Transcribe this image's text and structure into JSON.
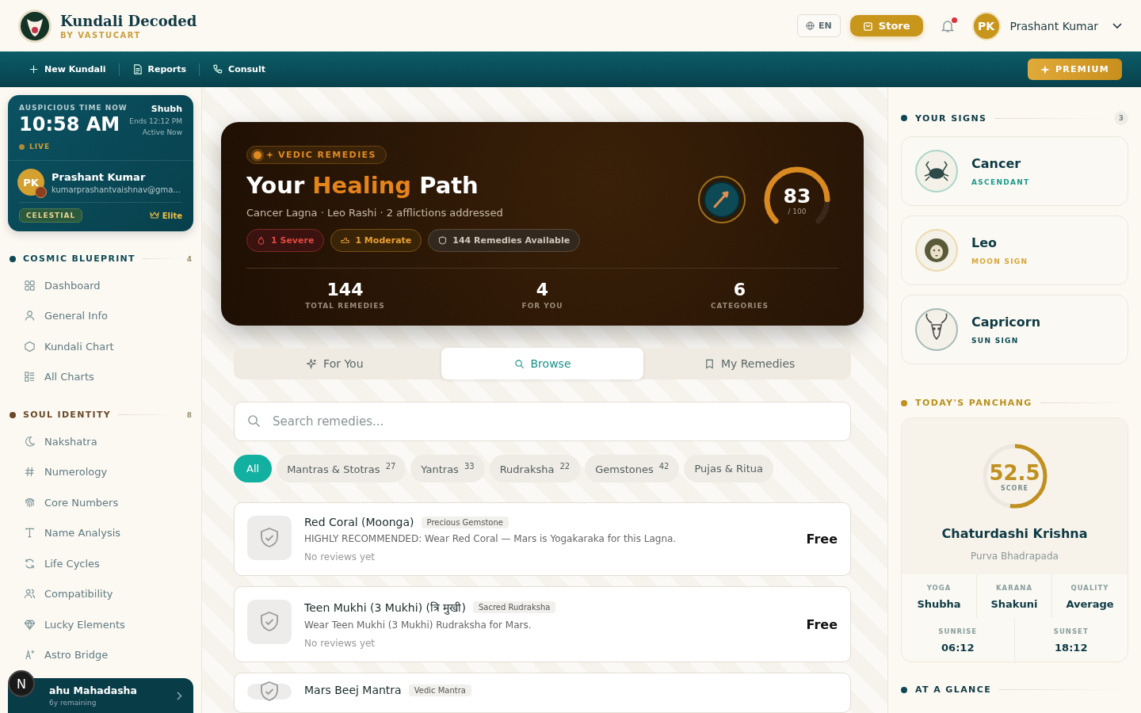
{
  "header": {
    "brand": "Kundali Decoded",
    "tagline": "BY VASTUCART",
    "language": "EN",
    "store": "Store",
    "notifications_unread": true,
    "user": {
      "initials": "PK",
      "name": "Prashant Kumar"
    }
  },
  "nav": {
    "items": [
      "New Kundali",
      "Reports",
      "Consult"
    ],
    "premium": "PREMIUM"
  },
  "auspicious": {
    "label": "AUSPICIOUS TIME NOW",
    "time": "10:58 AM",
    "period": "Shubh",
    "ends": "Ends 12:12 PM",
    "status": "Active Now",
    "live": "LIVE"
  },
  "profile": {
    "initials": "PK",
    "name": "Prashant Kumar",
    "email": "kumarprashantvaishnav@gma...",
    "tier": "CELESTIAL",
    "plan": "Elite"
  },
  "sidebar": [
    {
      "title": "COSMIC BLUEPRINT",
      "count": "4",
      "color": "#0d4a55",
      "items": [
        "Dashboard",
        "General Info",
        "Kundali Chart",
        "All Charts"
      ]
    },
    {
      "title": "SOUL IDENTITY",
      "count": "8",
      "color": "#6b4a2a",
      "items": [
        "Nakshatra",
        "Numerology",
        "Core Numbers",
        "Name Analysis",
        "Life Cycles",
        "Compatibility",
        "Lucky Elements",
        "Astro Bridge"
      ]
    }
  ],
  "mahadasha": {
    "title": "ahu Mahadasha",
    "remaining": "6y remaining"
  },
  "dev_badge": "N",
  "hero": {
    "badge": "VEDIC REMEDIES",
    "title_start": "Your",
    "title_highlight": "Healing",
    "title_end": "Path",
    "subtitle": "Cancer Lagna · Leo Rashi · 2 afflictions addressed",
    "chips": [
      {
        "kind": "severe",
        "label": "1 Severe"
      },
      {
        "kind": "moderate",
        "label": "1 Moderate"
      },
      {
        "kind": "info",
        "label": "144 Remedies Available"
      }
    ],
    "score": {
      "value": "83",
      "max": "/ 100",
      "level": 0.83
    },
    "stats": [
      {
        "value": "144",
        "label": "TOTAL REMEDIES"
      },
      {
        "value": "4",
        "label": "FOR YOU"
      },
      {
        "value": "6",
        "label": "CATEGORIES"
      }
    ]
  },
  "tabs": [
    {
      "label": "For You",
      "selected": false
    },
    {
      "label": "Browse",
      "selected": true
    },
    {
      "label": "My Remedies",
      "selected": false
    }
  ],
  "search": {
    "placeholder": "Search remedies..."
  },
  "categories": [
    {
      "label": "All",
      "selected": true
    },
    {
      "label": "Mantras & Stotras",
      "count": "27",
      "selected": false
    },
    {
      "label": "Yantras",
      "count": "33",
      "selected": false
    },
    {
      "label": "Rudraksha",
      "count": "22",
      "selected": false
    },
    {
      "label": "Gemstones",
      "count": "42",
      "selected": false
    },
    {
      "label": "Pujas & Ritua",
      "selected": false
    }
  ],
  "remedies": [
    {
      "name": "Red Coral (Moonga)",
      "tag": "Precious Gemstone",
      "description": "HIGHLY RECOMMENDED: Wear Red Coral — Mars is Yogakaraka for this Lagna.",
      "reviews": "No reviews yet",
      "price": "Free"
    },
    {
      "name": "Teen Mukhi (3 Mukhi) (त्रि मुखी)",
      "tag": "Sacred Rudraksha",
      "description": "Wear Teen Mukhi (3 Mukhi) Rudraksha for Mars.",
      "reviews": "No reviews yet",
      "price": "Free"
    },
    {
      "name": "Mars Beej Mantra",
      "tag": "Vedic Mantra"
    }
  ],
  "signs": {
    "title": "YOUR SIGNS",
    "count": "3",
    "items": [
      {
        "name": "Cancer",
        "role": "ASCENDANT",
        "color": "#1a9a8a"
      },
      {
        "name": "Leo",
        "role": "MOON SIGN",
        "color": "#d9a63a"
      },
      {
        "name": "Capricorn",
        "role": "SUN SIGN",
        "color": "#0d4a55"
      }
    ]
  },
  "panchang": {
    "title": "TODAY'S PANCHANG",
    "score": "52.5",
    "score_label": "SCORE",
    "level": 0.525,
    "tithi": "Chaturdashi Krishna",
    "nakshatra": "Purva Bhadrapada",
    "details": [
      {
        "label": "YOGA",
        "value": "Shubha"
      },
      {
        "label": "KARANA",
        "value": "Shakuni"
      },
      {
        "label": "QUALITY",
        "value": "Average"
      }
    ],
    "times": [
      {
        "label": "SUNRISE",
        "value": "06:12"
      },
      {
        "label": "SUNSET",
        "value": "18:12"
      }
    ]
  },
  "glance": {
    "title": "AT A GLANCE"
  }
}
